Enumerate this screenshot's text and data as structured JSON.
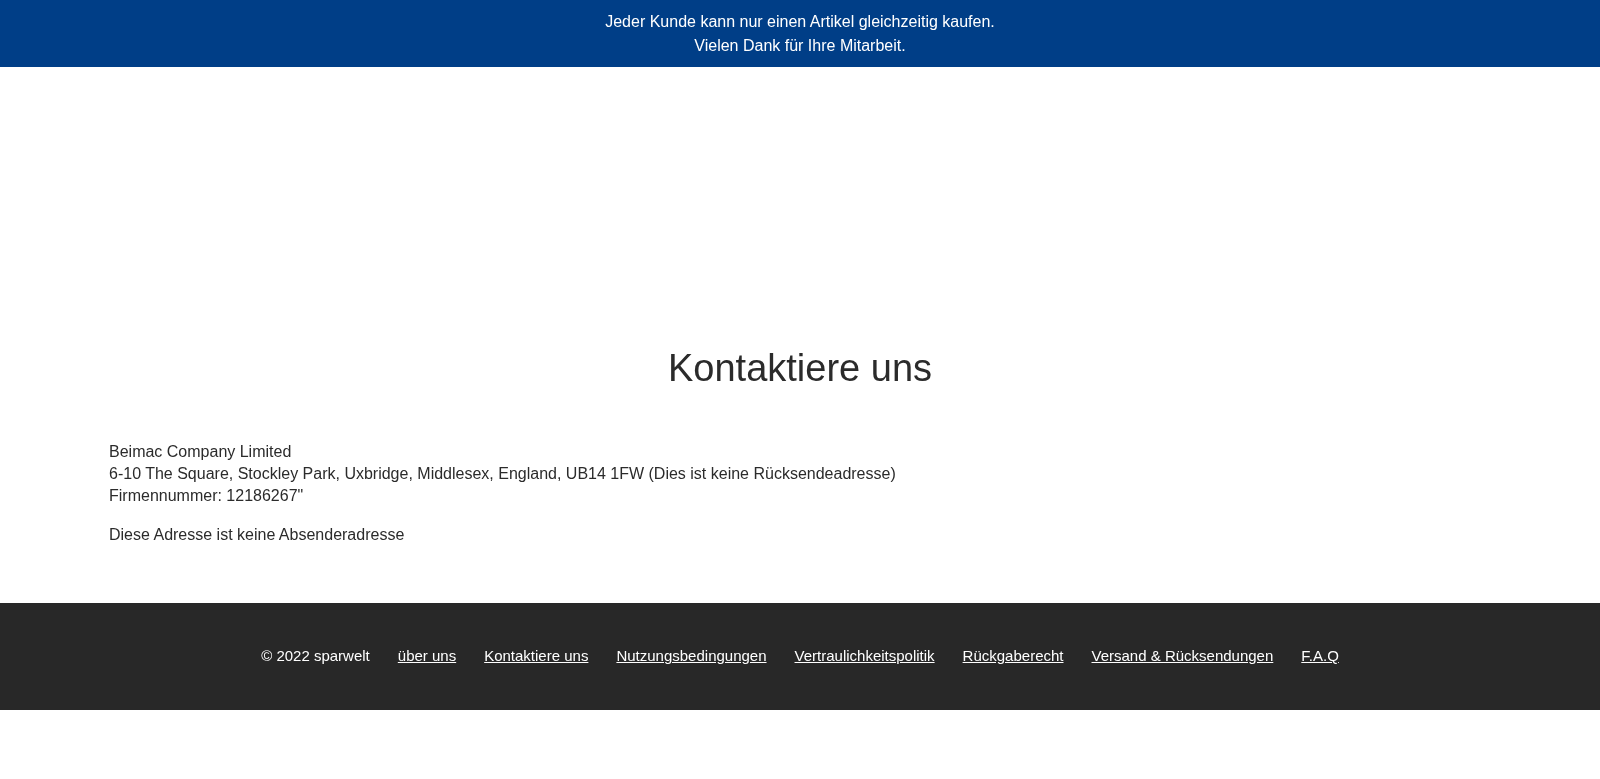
{
  "announcement": [
    "Jeder Kunde kann nur einen Artikel gleichzeitig kaufen.",
    "Vielen Dank für Ihre Mitarbeit."
  ],
  "page_title": "Kontaktiere uns",
  "address_lines": [
    "Beimac Company Limited",
    "6-10 The Square, Stockley Park, Uxbridge, Middlesex, England, UB14 1FW (Dies ist keine Rücksendeadresse)",
    "Firmennummer: 12186267\""
  ],
  "note": "Diese Adresse ist keine Absenderadresse",
  "footer": {
    "copyright": "© 2022 sparwelt",
    "links": [
      "über uns",
      "Kontaktiere uns",
      "Nutzungsbedingungen",
      "Vertraulichkeitspolitik",
      "Rückgaberecht",
      "Versand & Rücksendungen",
      "F.A.Q"
    ]
  }
}
